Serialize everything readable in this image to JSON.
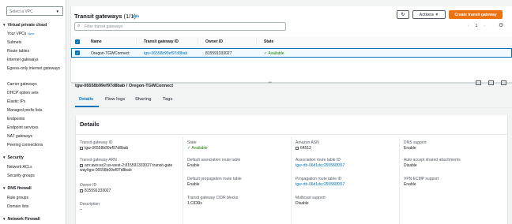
{
  "sidebar": {
    "vpc_filter_placeholder": "Select a VPC",
    "sections": [
      {
        "label": "Virtual private cloud",
        "items": [
          "Your VPCs",
          "Subnets",
          "Route tables",
          "Internet gateways",
          "Egress-only internet gateways",
          "Carrier gateways",
          "DHCP option sets",
          "Elastic IPs",
          "Managed prefix lists",
          "Endpoints",
          "Endpoint services",
          "NAT gateways",
          "Peering connections"
        ]
      },
      {
        "label": "Security",
        "items": [
          "Network ACLs",
          "Security groups"
        ]
      },
      {
        "label": "DNS firewall",
        "items": [
          "Rule groups",
          "Domain lists"
        ]
      },
      {
        "label": "Network Firewall",
        "items": []
      }
    ],
    "new_badge": "New"
  },
  "panel": {
    "title": "Transit gateways",
    "count": "(1/1)",
    "info": "Info",
    "actions_label": "Actions",
    "create_label": "Create transit gateway",
    "filter_placeholder": "Filter transit gateways",
    "page": "1",
    "columns": [
      "Name",
      "Transit gateway ID",
      "Owner ID",
      "State"
    ],
    "rows": [
      {
        "name": "Oregon-TGWConnect",
        "id": "tgw-06558b99ef97d8bab",
        "owner": "815591333027",
        "state": "Available"
      }
    ]
  },
  "detail": {
    "cut_title": "tgw-06558b99ef97d8bab / Oregon-TGWConnect",
    "tabs": [
      "Details",
      "Flow logs",
      "Sharing",
      "Tags"
    ],
    "active_tab": "Details",
    "section_title": "Details",
    "col1": [
      {
        "k": "Transit gateway ID",
        "v": "tgw-06558b99ef97d8bab"
      },
      {
        "k": "Transit gateway ARN",
        "v": "arn:aws:ec2:us-west-2:815591333027:transit-gateway/tgw-06558b99ef97d8bab"
      },
      {
        "k": "Owner ID",
        "v": "815591333027"
      },
      {
        "k": "Description",
        "v": "–"
      }
    ],
    "col2": [
      {
        "k": "State",
        "v": "Available"
      },
      {
        "k": "Default association route table",
        "v": "Enable"
      },
      {
        "k": "Default propagation route table",
        "v": "Enable"
      },
      {
        "k": "Transit gateway CIDR blocks",
        "v": "1 CIDRs"
      }
    ],
    "col3": [
      {
        "k": "Amazon ASN",
        "v": "64512"
      },
      {
        "k": "Association route table ID",
        "v": "tgw-rtb-06d1dcc255580f357"
      },
      {
        "k": "Propagation route table ID",
        "v": "tgw-rtb-06d1dcc255580f357"
      },
      {
        "k": "Multicast support",
        "v": "Disable"
      }
    ],
    "col4": [
      {
        "k": "DNS support",
        "v": "Enable"
      },
      {
        "k": "Auto accept shared attachments",
        "v": "Disable"
      },
      {
        "k": "VPN ECMP support",
        "v": "Enable"
      }
    ]
  },
  "colors": {
    "accent": "#0073bb",
    "primary_button": "#ec7211",
    "success": "#1d8102"
  }
}
